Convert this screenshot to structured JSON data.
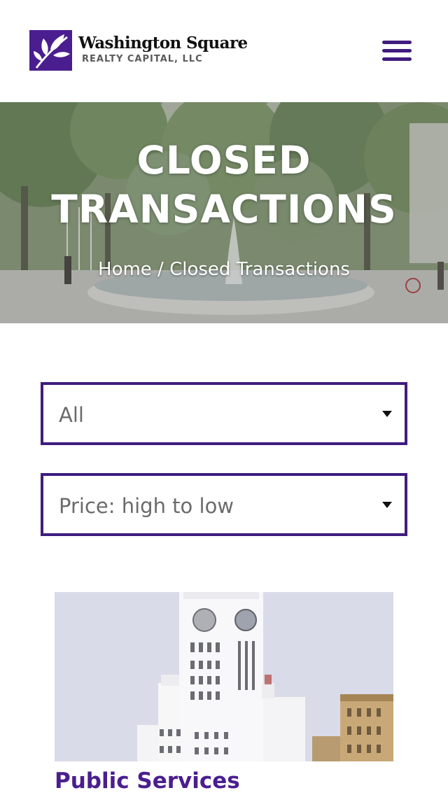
{
  "brand": {
    "name": "Washington Square",
    "subtitle": "REALTY CAPITAL, LLC",
    "primary_color": "#3f1c7e",
    "logo_icon": "leaf-icon"
  },
  "header": {
    "menu_icon": "hamburger-menu-icon"
  },
  "hero": {
    "title_line1": "CLOSED",
    "title_line2": "TRANSACTIONS",
    "breadcrumb_home": "Home",
    "breadcrumb_separator": " / ",
    "breadcrumb_current": "Closed Transactions"
  },
  "filters": {
    "category_selected": "All",
    "sort_selected": "Price: high to low"
  },
  "listing": {
    "title": "Public Services"
  }
}
